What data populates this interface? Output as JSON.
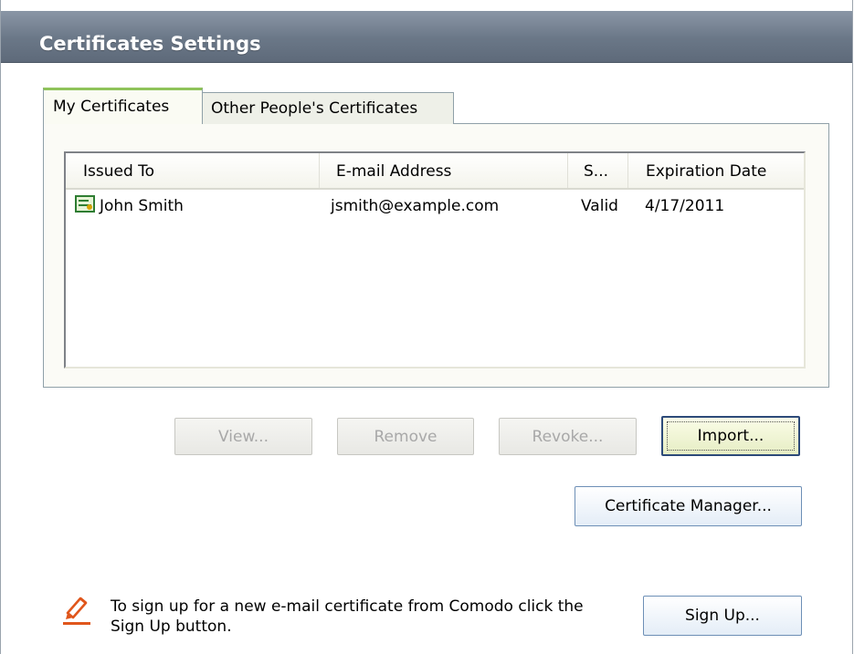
{
  "window": {
    "title": "Certificates Settings"
  },
  "tabs": [
    {
      "label": "My Certificates",
      "active": true
    },
    {
      "label": "Other People's Certificates",
      "active": false
    }
  ],
  "table": {
    "columns": [
      "Issued To",
      "E-mail Address",
      "S...",
      "Expiration Date"
    ],
    "rows": [
      {
        "issued_to": "John Smith",
        "email": "jsmith@example.com",
        "status": "Valid",
        "expiration": "4/17/2011",
        "icon": "certificate-icon"
      }
    ]
  },
  "buttons": {
    "view": "View...",
    "remove": "Remove",
    "revoke": "Revoke...",
    "import": "Import...",
    "certificate_manager": "Certificate Manager...",
    "sign_up": "Sign Up..."
  },
  "signup": {
    "text": "To sign up for a new e-mail certificate from Comodo click the Sign Up button.",
    "icon": "pencil-sign-icon"
  },
  "colors": {
    "title_bar": "#6a7787",
    "active_tab_accent": "#8fc35a",
    "default_button_border": "#2d4a79",
    "signup_icon": "#e0561c"
  }
}
